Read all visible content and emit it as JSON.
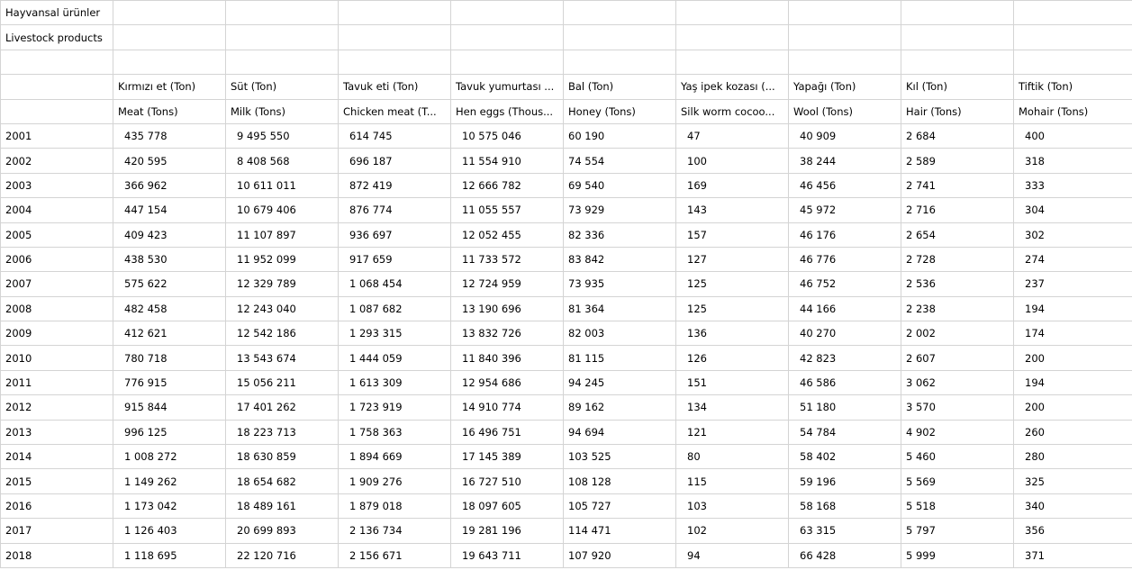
{
  "title_tr": "Hayvansal ürünler",
  "title_en": "Livestock products",
  "headers_tr": [
    "Kırmızı et (Ton)",
    "Süt (Ton)",
    "Tavuk eti (Ton)",
    "Tavuk yumurtası ...",
    "Bal (Ton)",
    "Yaş ipek kozası (...",
    "Yapağı (Ton)",
    "Kıl (Ton)",
    "Tiftik (Ton)"
  ],
  "headers_en": [
    "Meat (Tons)",
    "Milk (Tons)",
    "Chicken meat (T...",
    "Hen eggs (Thous...",
    "Honey (Tons)",
    "Silk worm cocoo...",
    "Wool (Tons)",
    "Hair (Tons)",
    "Mohair (Tons)"
  ],
  "rows": [
    {
      "year": "2001",
      "values": [
        "435 778",
        "9 495 550",
        "614 745",
        "10 575 046",
        "60 190",
        "47",
        "40 909",
        "2 684",
        "400"
      ]
    },
    {
      "year": "2002",
      "values": [
        "420 595",
        "8 408 568",
        "696 187",
        "11 554 910",
        "74 554",
        "100",
        "38 244",
        "2 589",
        "318"
      ]
    },
    {
      "year": "2003",
      "values": [
        "366 962",
        "10 611 011",
        "872 419",
        "12 666 782",
        "69 540",
        "169",
        "46 456",
        "2 741",
        "333"
      ]
    },
    {
      "year": "2004",
      "values": [
        "447 154",
        "10 679 406",
        "876 774",
        "11 055 557",
        "73 929",
        "143",
        "45 972",
        "2 716",
        "304"
      ]
    },
    {
      "year": "2005",
      "values": [
        "409 423",
        "11 107 897",
        "936 697",
        "12 052 455",
        "82 336",
        "157",
        "46 176",
        "2 654",
        "302"
      ]
    },
    {
      "year": "2006",
      "values": [
        "438 530",
        "11 952 099",
        "917 659",
        "11 733 572",
        "83 842",
        "127",
        "46 776",
        "2 728",
        "274"
      ]
    },
    {
      "year": "2007",
      "values": [
        "575 622",
        "12 329 789",
        "1 068 454",
        "12 724 959",
        "73 935",
        "125",
        "46 752",
        "2 536",
        "237"
      ]
    },
    {
      "year": "2008",
      "values": [
        "482 458",
        "12 243 040",
        "1 087 682",
        "13 190 696",
        "81 364",
        "125",
        "44 166",
        "2 238",
        "194"
      ]
    },
    {
      "year": "2009",
      "values": [
        "412 621",
        "12 542 186",
        "1 293 315",
        "13 832 726",
        "82 003",
        "136",
        "40 270",
        "2 002",
        "174"
      ]
    },
    {
      "year": "2010",
      "values": [
        "780 718",
        "13 543 674",
        "1 444 059",
        "11 840 396",
        "81 115",
        "126",
        "42 823",
        "2 607",
        "200"
      ]
    },
    {
      "year": "2011",
      "values": [
        "776 915",
        "15 056 211",
        "1 613 309",
        "12 954 686",
        "94 245",
        "151",
        "46 586",
        "3 062",
        "194"
      ]
    },
    {
      "year": "2012",
      "values": [
        "915 844",
        "17 401 262",
        "1 723 919",
        "14 910 774",
        "89 162",
        "134",
        "51 180",
        "3 570",
        "200"
      ]
    },
    {
      "year": "2013",
      "values": [
        "996 125",
        "18 223 713",
        "1 758 363",
        "16 496 751",
        "94 694",
        "121",
        "54 784",
        "4 902",
        "260"
      ]
    },
    {
      "year": "2014",
      "values": [
        "1 008 272",
        "18 630 859",
        "1 894 669",
        "17 145 389",
        "103 525",
        "80",
        "58 402",
        "5 460",
        "280"
      ]
    },
    {
      "year": "2015",
      "values": [
        "1 149 262",
        "18 654 682",
        "1 909 276",
        "16 727 510",
        "108 128",
        "115",
        "59 196",
        "5 569",
        "325"
      ]
    },
    {
      "year": "2016",
      "values": [
        "1 173 042",
        "18 489 161",
        "1 879 018",
        "18 097 605",
        "105 727",
        "103",
        "58 168",
        "5 518",
        "340"
      ]
    },
    {
      "year": "2017",
      "values": [
        "1 126 403",
        "20 699 893",
        "2 136 734",
        "19 281 196",
        "114 471",
        "102",
        "63 315",
        "5 797",
        "356"
      ]
    },
    {
      "year": "2018",
      "values": [
        "1 118 695",
        "22 120 716",
        "2 156 671",
        "19 643 711",
        "107 920",
        "94",
        "66 428",
        "5 999",
        "371"
      ]
    }
  ]
}
